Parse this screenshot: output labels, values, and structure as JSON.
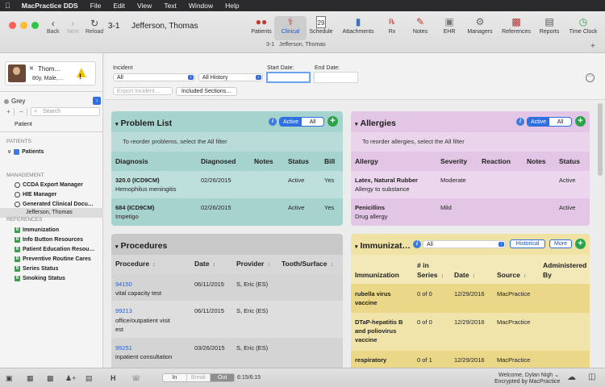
{
  "menubar": {
    "apple": "",
    "app": "MacPractice DDS",
    "items": [
      "File",
      "Edit",
      "View",
      "Text",
      "Window",
      "Help"
    ]
  },
  "window": {
    "lights": [
      "#fe5f57",
      "#febc2e",
      "#28c840"
    ]
  },
  "nav": {
    "back": "Back",
    "next": "Next",
    "reload": "Reload"
  },
  "patient": {
    "id": "3-1",
    "name": "Jefferson, Thomas",
    "sub_id": "3-1",
    "sub_name": "Jefferson, Thomas",
    "card_name": "Thom…",
    "age": "80y, Male,…"
  },
  "toolbar": [
    {
      "label": "Patients",
      "icon": "patients-icon"
    },
    {
      "label": "Clinical",
      "icon": "clinical-icon",
      "selected": true
    },
    {
      "label": "Schedule",
      "icon": "schedule-icon",
      "glyph": "29"
    },
    {
      "label": "Attachments",
      "icon": "attachments-icon"
    },
    {
      "label": "Rx",
      "icon": "rx-icon"
    },
    {
      "label": "Notes",
      "icon": "notes-icon"
    },
    {
      "label": "EHR",
      "icon": "ehr-icon"
    },
    {
      "label": "Managers",
      "icon": "managers-icon"
    },
    {
      "label": "References",
      "icon": "references-icon"
    },
    {
      "label": "Reports",
      "icon": "reports-icon"
    },
    {
      "label": "Time Clock",
      "icon": "time-clock-icon"
    }
  ],
  "sidebar": {
    "group": "Grey",
    "search_placeholder": "Search",
    "root": "Patient",
    "sections": {
      "patients": "PATIENTS",
      "management": "MANAGEMENT",
      "references": "REFERENCES"
    },
    "patients_folder": "Patients",
    "patients_child": "Jefferson, Thomas",
    "management": [
      "CCDA Export Manager",
      "HIE Manager",
      "Generated Clinical Docu…"
    ],
    "references": [
      "Immunization",
      "Info Button Resources",
      "Patient Education Resou…",
      "Preventive Routine Cares",
      "Series Status",
      "Smoking Status"
    ]
  },
  "filters": {
    "incident_label": "Incident",
    "incident_value": "All",
    "history_value": "All History",
    "start_label": "Start Date:",
    "end_label": "End Date:",
    "export_label": "Export Incident…",
    "sections_label": "Included Sections…"
  },
  "problem_list": {
    "title": "Problem List",
    "seg": [
      "Active",
      "All"
    ],
    "hint": "To reorder problems, select the All filter",
    "headers": [
      "Diagnosis",
      "Diagnosed",
      "Notes",
      "Status",
      "Bill"
    ],
    "rows": [
      {
        "code": "320.0 (ICD9CM)",
        "desc": "Hemophilus meningitis",
        "date": "02/26/2015",
        "status": "Active",
        "bill": "Yes"
      },
      {
        "code": "684 (ICD9CM)",
        "desc": "Impetigo",
        "date": "02/26/2015",
        "status": "Active",
        "bill": "Yes"
      }
    ],
    "color": "#a7d3ce"
  },
  "allergies": {
    "title": "Allergies",
    "seg": [
      "Active",
      "All"
    ],
    "hint": "To reorder allergies, select the All filter",
    "headers": [
      "Allergy",
      "Severity",
      "Reaction",
      "Notes",
      "Status"
    ],
    "rows": [
      {
        "name": "Latex, Natural Rubber",
        "type": "Allergy to substance",
        "severity": "Moderate",
        "status": "Active"
      },
      {
        "name": "Penicillins",
        "type": "Drug allergy",
        "severity": "Mild",
        "status": "Active"
      }
    ],
    "color": "#e3c6e6"
  },
  "procedures": {
    "title": "Procedures",
    "headers": [
      "Procedure",
      "Date",
      "Provider",
      "Tooth/Surface"
    ],
    "rows": [
      {
        "code": "94150",
        "desc": "vital capacity test",
        "date": "06/11/2015",
        "provider": "S, Eric (ES)"
      },
      {
        "code": "99213",
        "desc": "office/outpatient visit",
        "desc2": "est",
        "date": "06/11/2015",
        "provider": "S, Eric (ES)"
      },
      {
        "code": "99251",
        "desc": "inpatient consultation",
        "date": "03/26/2015",
        "provider": "S, Eric (ES)"
      }
    ],
    "color": "#c8c8c8"
  },
  "immunizations": {
    "title": "Immunizat…",
    "filter": "All",
    "historical": "Historical",
    "more": "More",
    "headers": [
      "Immunization",
      "# in",
      "Series",
      "Date",
      "Source",
      "Administered",
      "By"
    ],
    "rows": [
      {
        "name": "rubella virus",
        "name2": "vaccine",
        "series": "0 of 0",
        "date": "12/29/2016",
        "source": "MacPractice"
      },
      {
        "name": "DTaP-hepatitis B",
        "name2": "and poliovirus",
        "name3": "vaccine",
        "series": "0 of 0",
        "date": "12/29/2016",
        "source": "MacPractice"
      },
      {
        "name": "respiratory",
        "series": "0 of 1",
        "date": "12/29/2016",
        "source": "MacPractice"
      }
    ],
    "color": "#efe2a4"
  },
  "footer": {
    "in": "In",
    "break": "Break",
    "out": "Out",
    "time": "6:15/6:15",
    "welcome": "Welcome, Dylan Nigh",
    "encrypted": "Encrypted by MacPractice"
  }
}
